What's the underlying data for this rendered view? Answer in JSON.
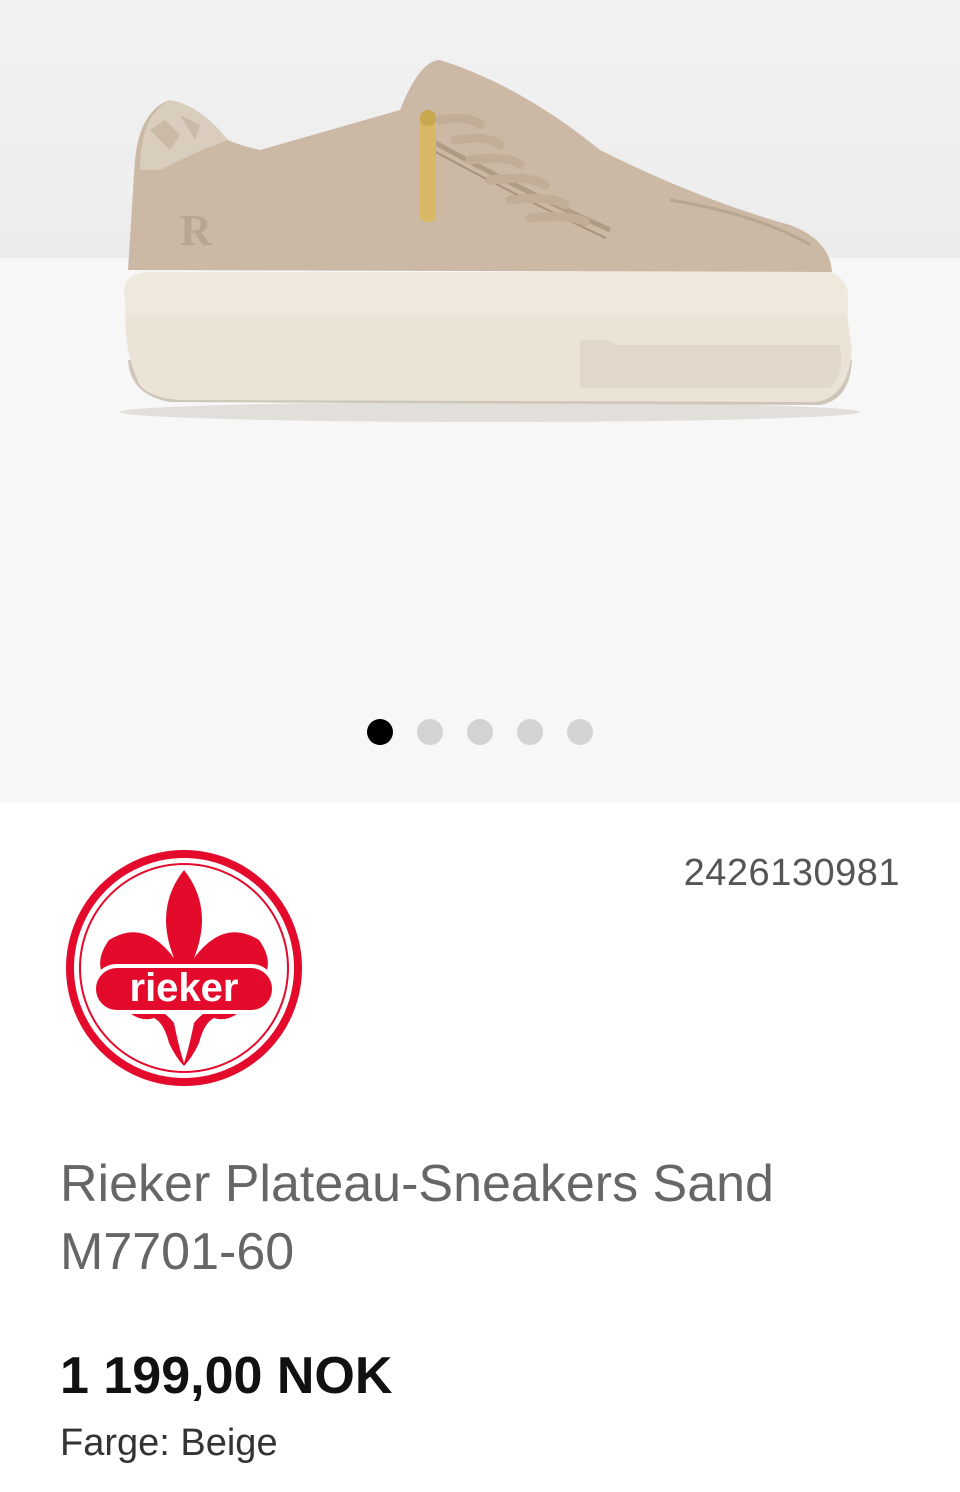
{
  "gallery": {
    "image": "Rieker Plateau-Sneakers Sand M7701-60",
    "slide_count": 5,
    "active_slide": 1
  },
  "brand": {
    "logo_text": "rieker",
    "logo_color": "#e30a2c"
  },
  "product": {
    "sku": "2426130981",
    "title": "Rieker Plateau-Sneakers Sand M7701-60",
    "price": "1 199,00 NOK",
    "color_label": "Farge: Beige"
  },
  "colors": {
    "background_top": "#f7f7f7",
    "dot_active": "#000000",
    "dot_inactive": "#d3d3d3"
  }
}
